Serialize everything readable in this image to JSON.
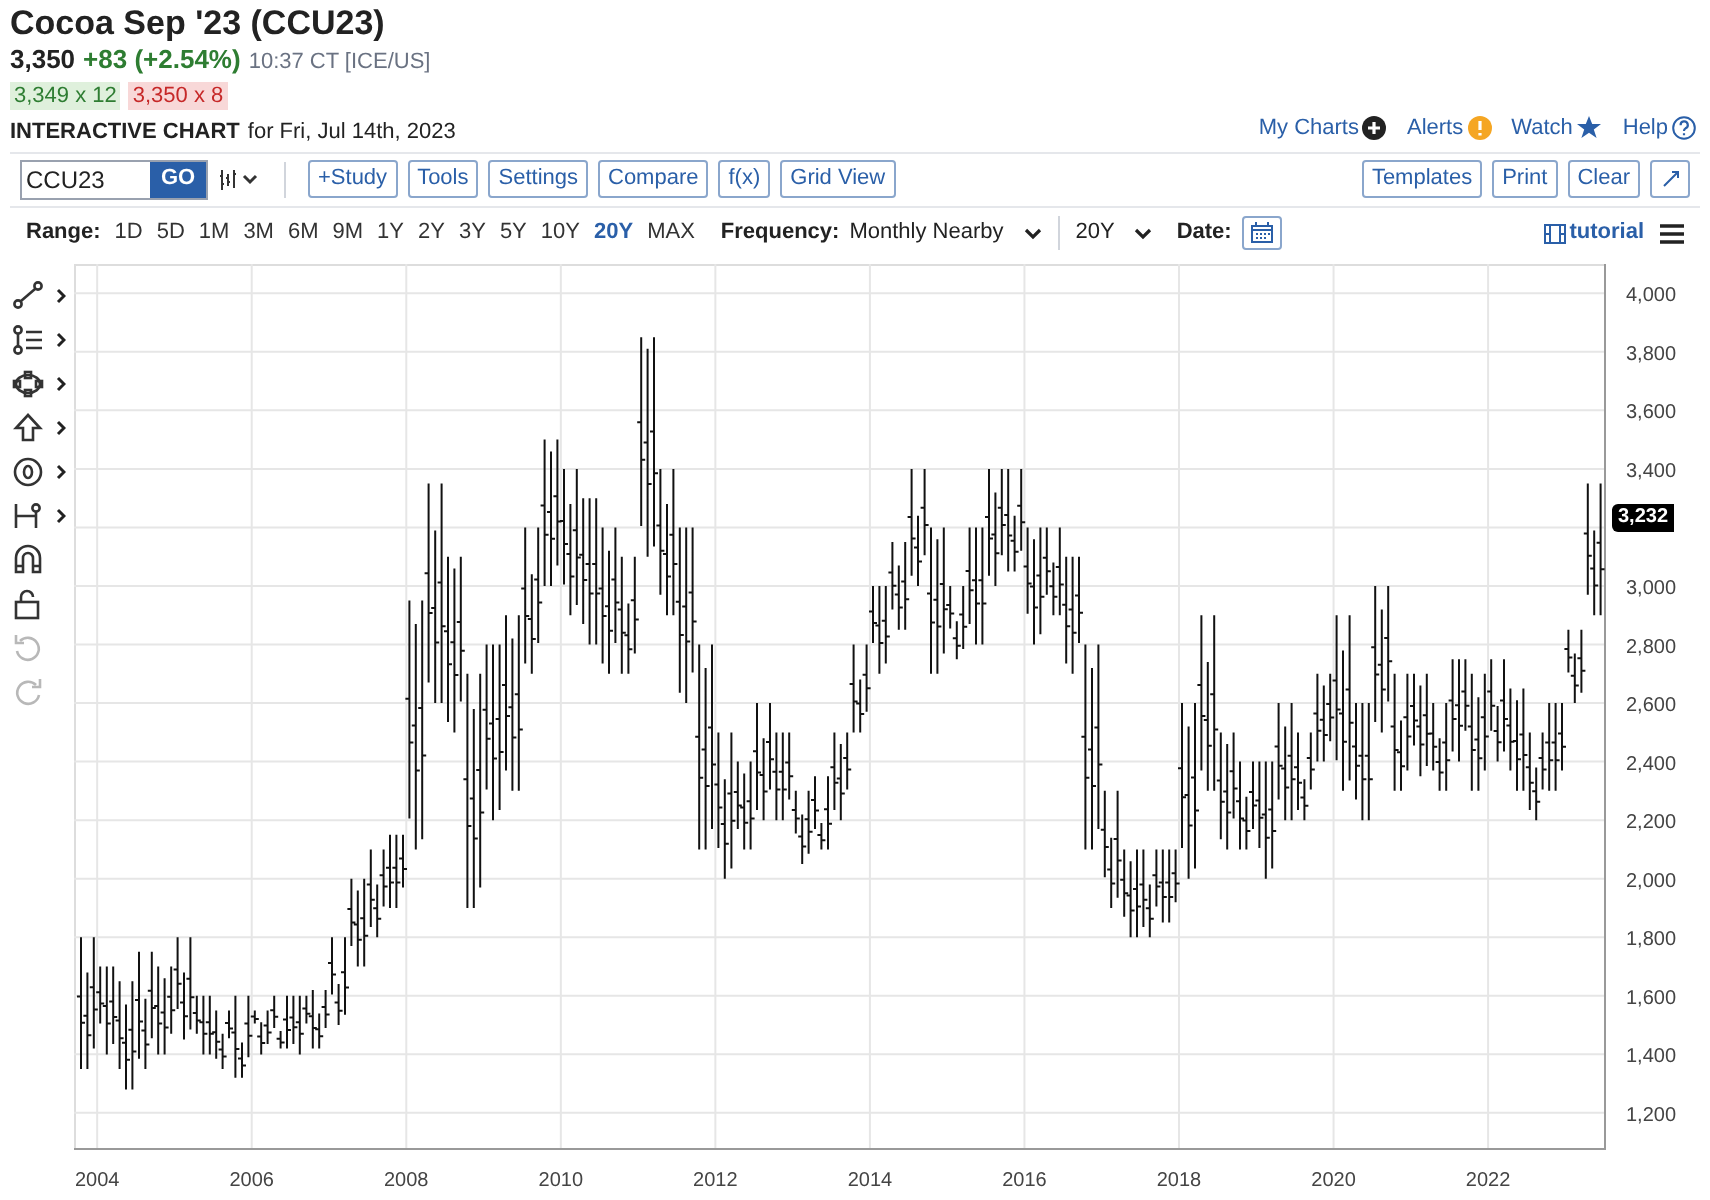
{
  "header": {
    "title": "Cocoa Sep '23 (CCU23)",
    "last": "3,350",
    "change": "+83 (+2.54%)",
    "time": "10:37 CT [ICE/US]",
    "bid": "3,349 x 12",
    "ask": "3,350 x 8",
    "chart_label": "INTERACTIVE CHART",
    "chart_date": "for Fri, Jul 14th, 2023"
  },
  "top_links": [
    {
      "label": "My Charts",
      "kind": "plus"
    },
    {
      "label": "Alerts",
      "kind": "alert"
    },
    {
      "label": "Watch",
      "kind": "star"
    },
    {
      "label": "Help",
      "kind": "help"
    }
  ],
  "symbol_field": {
    "value": "CCU23"
  },
  "go_button": "GO",
  "toolbar_buttons": [
    "+Study",
    "Tools",
    "Settings",
    "Compare",
    "f(x)",
    "Grid View"
  ],
  "right_buttons": [
    "Templates",
    "Print",
    "Clear"
  ],
  "range": {
    "label": "Range:",
    "options": [
      {
        "label": "1D",
        "selected": false
      },
      {
        "label": "5D",
        "selected": false
      },
      {
        "label": "1M",
        "selected": false
      },
      {
        "label": "3M",
        "selected": false
      },
      {
        "label": "6M",
        "selected": false
      },
      {
        "label": "9M",
        "selected": false
      },
      {
        "label": "1Y",
        "selected": false
      },
      {
        "label": "2Y",
        "selected": false
      },
      {
        "label": "3Y",
        "selected": false
      },
      {
        "label": "5Y",
        "selected": false
      },
      {
        "label": "10Y",
        "selected": false
      },
      {
        "label": "20Y",
        "selected": true
      },
      {
        "label": "MAX",
        "selected": false
      }
    ]
  },
  "frequency": {
    "label": "Frequency:",
    "value": "Monthly Nearby"
  },
  "period": {
    "value": "20Y"
  },
  "date": {
    "label": "Date:"
  },
  "tutorial": "tutorial",
  "drawing_tools": [
    {
      "kind": "line",
      "submenu": true,
      "disabled": false
    },
    {
      "kind": "fib",
      "submenu": true,
      "disabled": false
    },
    {
      "kind": "shape",
      "submenu": true,
      "disabled": false
    },
    {
      "kind": "arrow",
      "submenu": true,
      "disabled": false
    },
    {
      "kind": "marker",
      "submenu": true,
      "disabled": false
    },
    {
      "kind": "measure",
      "submenu": true,
      "disabled": false
    },
    {
      "kind": "magnet",
      "submenu": false,
      "disabled": false
    },
    {
      "kind": "lock",
      "submenu": false,
      "disabled": false
    },
    {
      "kind": "undo",
      "submenu": false,
      "disabled": true
    },
    {
      "kind": "redo",
      "submenu": false,
      "disabled": true
    }
  ],
  "price_tag": "3,232",
  "chart": {
    "x_axis_labels": [
      "2004",
      "2006",
      "2008",
      "2010",
      "2012",
      "2014",
      "2016",
      "2018",
      "2020",
      "2022"
    ],
    "y_axis_labels": [
      "4,000",
      "3,800",
      "3,600",
      "3,400",
      "3,000",
      "2,800",
      "2,600",
      "2,400",
      "2,200",
      "2,000",
      "1,800",
      "1,600",
      "1,400",
      "1,200"
    ]
  }
}
